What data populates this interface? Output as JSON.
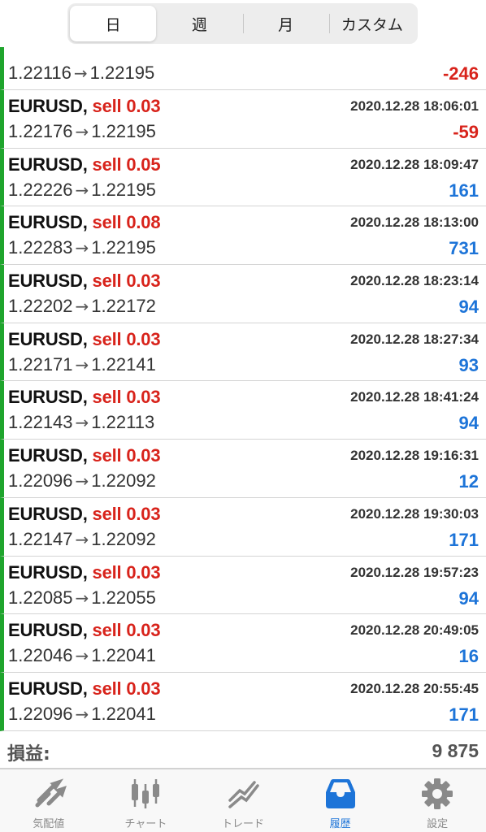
{
  "period_tabs": [
    {
      "label": "日",
      "active": true
    },
    {
      "label": "週",
      "active": false
    },
    {
      "label": "月",
      "active": false
    },
    {
      "label": "カスタム",
      "active": false
    }
  ],
  "colors": {
    "sell": "#d8231b",
    "profit_negative": "#d8231b",
    "profit_positive": "#1d74d8",
    "deal_marker": "#1fa52d",
    "active_tab": "#1d74d8"
  },
  "partial_top_deal": {
    "prices_open": "1.22116",
    "prices_close": "1.22195",
    "profit": "-246"
  },
  "deals": [
    {
      "symbol": "EURUSD,",
      "side": "sell 0.03",
      "time": "2020.12.28 18:06:01",
      "open": "1.22176",
      "close": "1.22195",
      "profit": "-59",
      "sign": "neg"
    },
    {
      "symbol": "EURUSD,",
      "side": "sell 0.05",
      "time": "2020.12.28 18:09:47",
      "open": "1.22226",
      "close": "1.22195",
      "profit": "161",
      "sign": "pos"
    },
    {
      "symbol": "EURUSD,",
      "side": "sell 0.08",
      "time": "2020.12.28 18:13:00",
      "open": "1.22283",
      "close": "1.22195",
      "profit": "731",
      "sign": "pos"
    },
    {
      "symbol": "EURUSD,",
      "side": "sell 0.03",
      "time": "2020.12.28 18:23:14",
      "open": "1.22202",
      "close": "1.22172",
      "profit": "94",
      "sign": "pos"
    },
    {
      "symbol": "EURUSD,",
      "side": "sell 0.03",
      "time": "2020.12.28 18:27:34",
      "open": "1.22171",
      "close": "1.22141",
      "profit": "93",
      "sign": "pos"
    },
    {
      "symbol": "EURUSD,",
      "side": "sell 0.03",
      "time": "2020.12.28 18:41:24",
      "open": "1.22143",
      "close": "1.22113",
      "profit": "94",
      "sign": "pos"
    },
    {
      "symbol": "EURUSD,",
      "side": "sell 0.03",
      "time": "2020.12.28 19:16:31",
      "open": "1.22096",
      "close": "1.22092",
      "profit": "12",
      "sign": "pos"
    },
    {
      "symbol": "EURUSD,",
      "side": "sell 0.03",
      "time": "2020.12.28 19:30:03",
      "open": "1.22147",
      "close": "1.22092",
      "profit": "171",
      "sign": "pos"
    },
    {
      "symbol": "EURUSD,",
      "side": "sell 0.03",
      "time": "2020.12.28 19:57:23",
      "open": "1.22085",
      "close": "1.22055",
      "profit": "94",
      "sign": "pos"
    },
    {
      "symbol": "EURUSD,",
      "side": "sell 0.03",
      "time": "2020.12.28 20:49:05",
      "open": "1.22046",
      "close": "1.22041",
      "profit": "16",
      "sign": "pos"
    },
    {
      "symbol": "EURUSD,",
      "side": "sell 0.03",
      "time": "2020.12.28 20:55:45",
      "open": "1.22096",
      "close": "1.22041",
      "profit": "171",
      "sign": "pos"
    }
  ],
  "arrow": "→",
  "summary": {
    "label": "損益:",
    "value": "9 875"
  },
  "tabbar": [
    {
      "label": "気配値",
      "icon": "quotes-icon",
      "active": false
    },
    {
      "label": "チャート",
      "icon": "chart-candles-icon",
      "active": false
    },
    {
      "label": "トレード",
      "icon": "trade-icon",
      "active": false
    },
    {
      "label": "履歴",
      "icon": "history-inbox-icon",
      "active": true
    },
    {
      "label": "設定",
      "icon": "settings-gear-icon",
      "active": false
    }
  ]
}
